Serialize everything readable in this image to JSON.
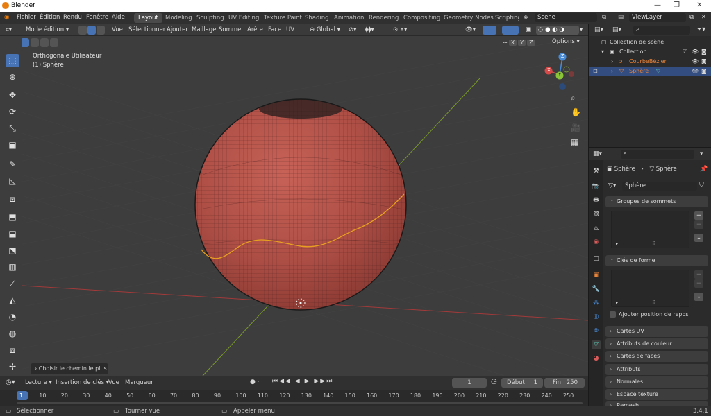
{
  "window": {
    "title": "Blender"
  },
  "menus": [
    "Fichier",
    "Édition",
    "Rendu",
    "Fenêtre",
    "Aide"
  ],
  "workspaces": [
    {
      "label": "Layout",
      "active": true
    },
    {
      "label": "Modeling"
    },
    {
      "label": "Sculpting"
    },
    {
      "label": "UV Editing"
    },
    {
      "label": "Texture Paint"
    },
    {
      "label": "Shading"
    },
    {
      "label": "Animation"
    },
    {
      "label": "Rendering"
    },
    {
      "label": "Compositing"
    },
    {
      "label": "Geometry Nodes"
    },
    {
      "label": "Scripting"
    }
  ],
  "scene": {
    "label": "Scene"
  },
  "view_layer": {
    "label": "ViewLayer"
  },
  "header": {
    "mode": "Mode édition",
    "menus": [
      "Vue",
      "Sélectionner",
      "Ajouter",
      "Maillage",
      "Sommet",
      "Arête",
      "Face",
      "UV"
    ],
    "orientation": "Global",
    "options": "Options",
    "axes": [
      "X",
      "Y",
      "Z"
    ]
  },
  "viewport": {
    "view_name": "Orthogonale Utilisateur",
    "object_name": "(1) Sphère",
    "operator_panel": "Choisir le chemin le plus c",
    "gizmo": {
      "x": "X",
      "y": "Y",
      "z": "Z"
    }
  },
  "outliner": {
    "root": "Collection de scène",
    "collection": "Collection",
    "items": [
      {
        "name": "CourbeBézier",
        "color": "#e8843a"
      },
      {
        "name": "Sphère",
        "color": "#e8843a",
        "selected": true
      }
    ]
  },
  "properties": {
    "breadcrumb_obj": "Sphère",
    "breadcrumb_data": "Sphère",
    "mesh_name": "Sphère",
    "panels": {
      "vertex_groups": "Groupes de sommets",
      "shape_keys": "Clés de forme",
      "add_rest": "Ajouter position de repos",
      "uv_maps": "Cartes UV",
      "color_attrs": "Attributs de couleur",
      "face_maps": "Cartes de faces",
      "attributes": "Attributs",
      "normals": "Normales",
      "texture_space": "Espace texture",
      "remesh": "Remesh"
    }
  },
  "timeline": {
    "menus": [
      "Lecture",
      "Insertion de clés",
      "Vue",
      "Marqueur"
    ],
    "current_frame": "1",
    "start_label": "Début",
    "start": "1",
    "end_label": "Fin",
    "end": "250",
    "ruler": [
      "1",
      "10",
      "20",
      "30",
      "40",
      "50",
      "60",
      "70",
      "80",
      "90",
      "100",
      "110",
      "120",
      "130",
      "140",
      "150",
      "160",
      "170",
      "180",
      "190",
      "200",
      "210",
      "220",
      "230",
      "240",
      "250"
    ]
  },
  "status": {
    "select": "Sélectionner",
    "rotate": "Tourner vue",
    "menu": "Appeler menu",
    "version": "3.4.1"
  },
  "colors": {
    "accent": "#4772b3",
    "sphere": "#b5544b",
    "curve": "#e8a020",
    "selected_row": "#334d80"
  }
}
